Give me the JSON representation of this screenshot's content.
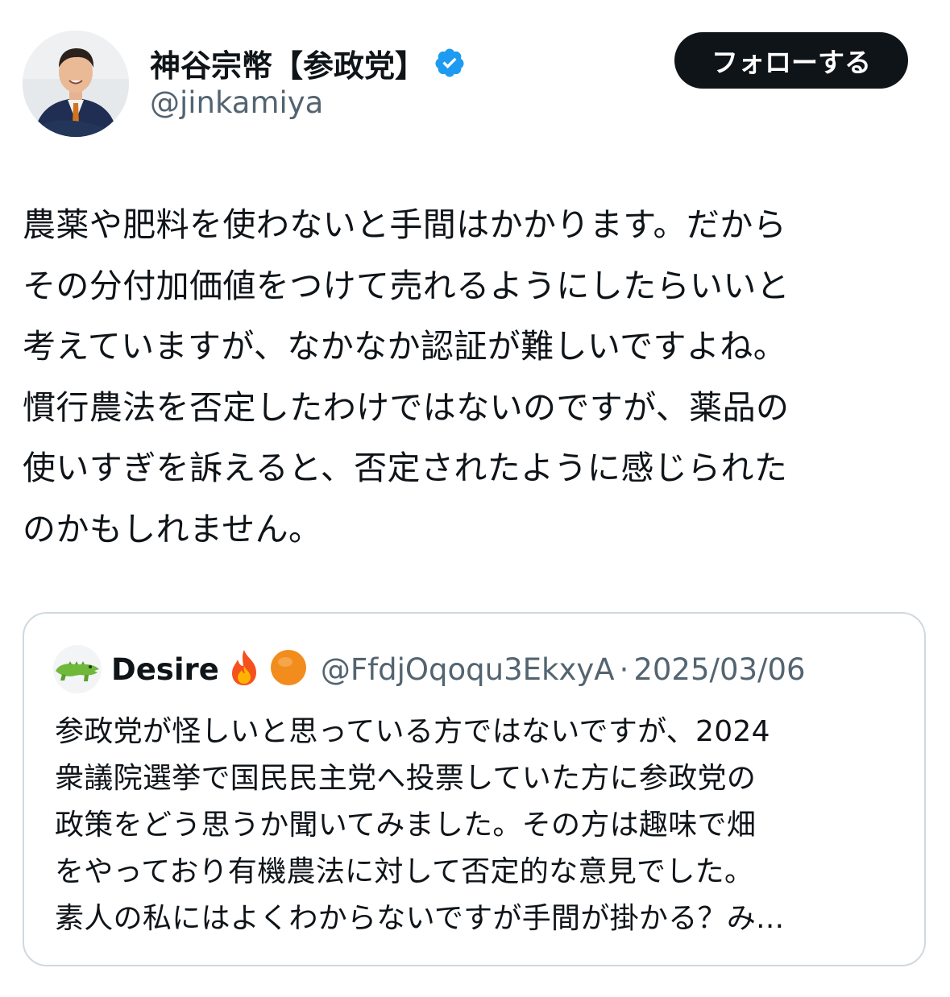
{
  "author": {
    "display_name": "神谷宗幣【参政党】",
    "handle": "@jinkamiya",
    "avatar_icon": "person-photo-avatar",
    "verified_icon": "verified-badge-icon",
    "verified_color": "#1d9bf0"
  },
  "follow_button": {
    "label": "フォローする",
    "bg_color": "#0f1419"
  },
  "tweet": {
    "lines": [
      "農薬や肥料を使わないと手間はかかります。だから",
      "その分付加価値をつけて売れるようにしたらいいと",
      "考えていますが、なかなか認証が難しいですよね。",
      "慣行農法を否定したわけではないのですが、薬品の",
      "使いすぎを訴えると、否定されたように感じられた",
      "のかもしれません。"
    ]
  },
  "quote": {
    "avatar_icon": "crocodile-icon",
    "display_name": "Desire",
    "name_emojis": [
      "fire-emoji",
      "orange-circle-emoji"
    ],
    "handle": "@FfdjOqoqu3EkxyA",
    "separator": "·",
    "date": "2025/03/06",
    "lines": [
      "参政党が怪しいと思っている方ではないですが、2024",
      "衆議院選挙で国民民主党へ投票していた方に参政党の",
      "政策をどう思うか聞いてみました。その方は趣味で畑",
      "をやっており有機農法に対して否定的な意見でした。",
      "素人の私にはよくわからないですが手間が掛かる？み..."
    ]
  }
}
